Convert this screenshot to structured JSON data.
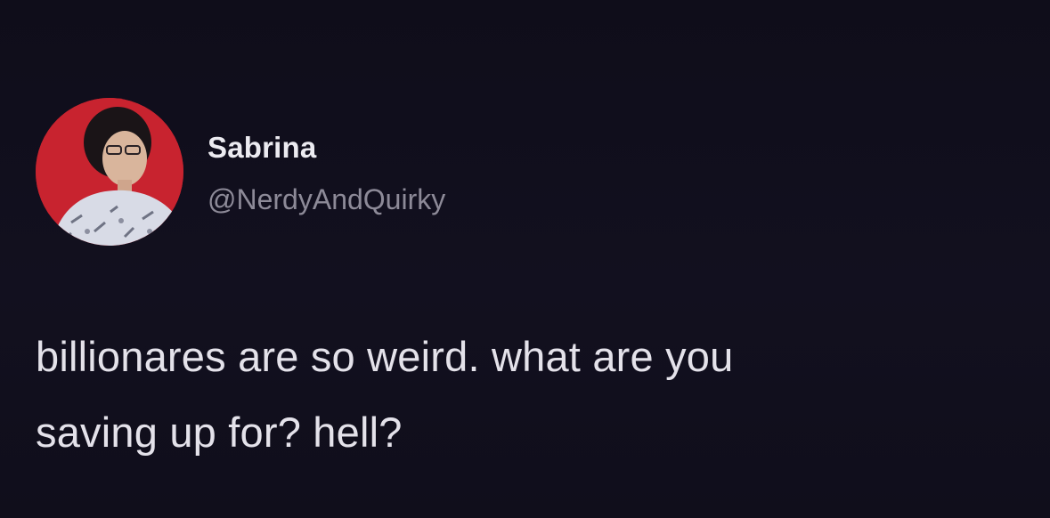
{
  "author": {
    "display_name": "Sabrina",
    "handle": "@NerdyAndQuirky",
    "avatar_icon": "profile-photo",
    "avatar_background_color": "#c8232f"
  },
  "tweet": {
    "lines": [
      "billionares are so weird. what are you",
      "saving up for? hell?"
    ]
  },
  "colors": {
    "background": "#100e1c",
    "name_text": "#ecebf1",
    "handle_text": "#8d8a98",
    "body_text": "#e4e2ea"
  }
}
